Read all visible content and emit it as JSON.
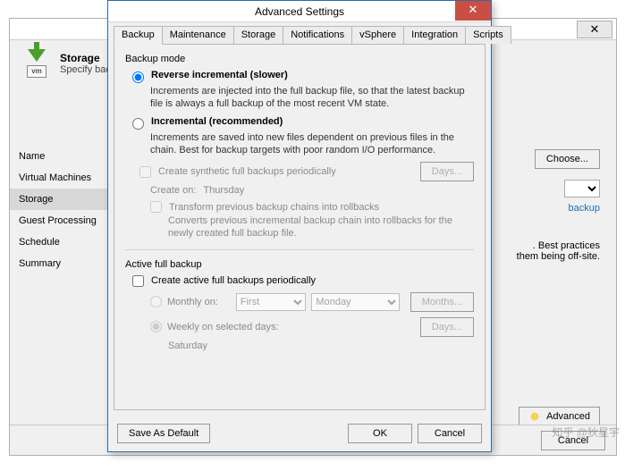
{
  "back": {
    "header_title": "Storage",
    "header_desc": "Specify backup repository to store backup files produced by this job and",
    "sidebar": [
      "Name",
      "Virtual Machines",
      "Storage",
      "Guest Processing",
      "Schedule",
      "Summary"
    ],
    "sidebar_selected": 2,
    "choose_btn": "Choose...",
    "link_text": "backup",
    "note_line1": ". Best practices",
    "note_line2": "them being off-site.",
    "advanced_btn": "Advanced",
    "footer_cancel": "Cancel",
    "vm_label": "vm"
  },
  "adv": {
    "title": "Advanced Settings",
    "close_glyph": "✕",
    "tabs": [
      "Backup",
      "Maintenance",
      "Storage",
      "Notifications",
      "vSphere",
      "Integration",
      "Scripts"
    ],
    "tab_selected": 0,
    "backup_mode": {
      "group_title": "Backup mode",
      "reverse": {
        "label": "Reverse incremental (slower)",
        "desc": "Increments are injected into the full backup file, so that the latest backup file is always a full backup of the most recent VM state."
      },
      "incremental": {
        "label": "Incremental (recommended)",
        "desc": "Increments are saved into new files dependent on previous files in the chain. Best for backup targets with poor random I/O performance."
      },
      "synthetic_label": "Create synthetic full backups periodically",
      "days_btn": "Days...",
      "create_on_label": "Create on:",
      "create_on_value": "Thursday",
      "transform_label": "Transform previous backup chains into rollbacks",
      "transform_desc": "Converts previous incremental backup chain into rollbacks for the newly created full backup file."
    },
    "active": {
      "group_title": "Active full backup",
      "create_label": "Create active full backups periodically",
      "monthly_label": "Monthly on:",
      "monthly_first": "First",
      "monthly_day": "Monday",
      "months_btn": "Months...",
      "weekly_label": "Weekly on selected days:",
      "weekly_days_btn": "Days...",
      "weekly_selected_day": "Saturday"
    },
    "footer": {
      "save_default": "Save As Default",
      "ok": "OK",
      "cancel": "Cancel"
    }
  },
  "watermark": "知乎 @狄星宇"
}
